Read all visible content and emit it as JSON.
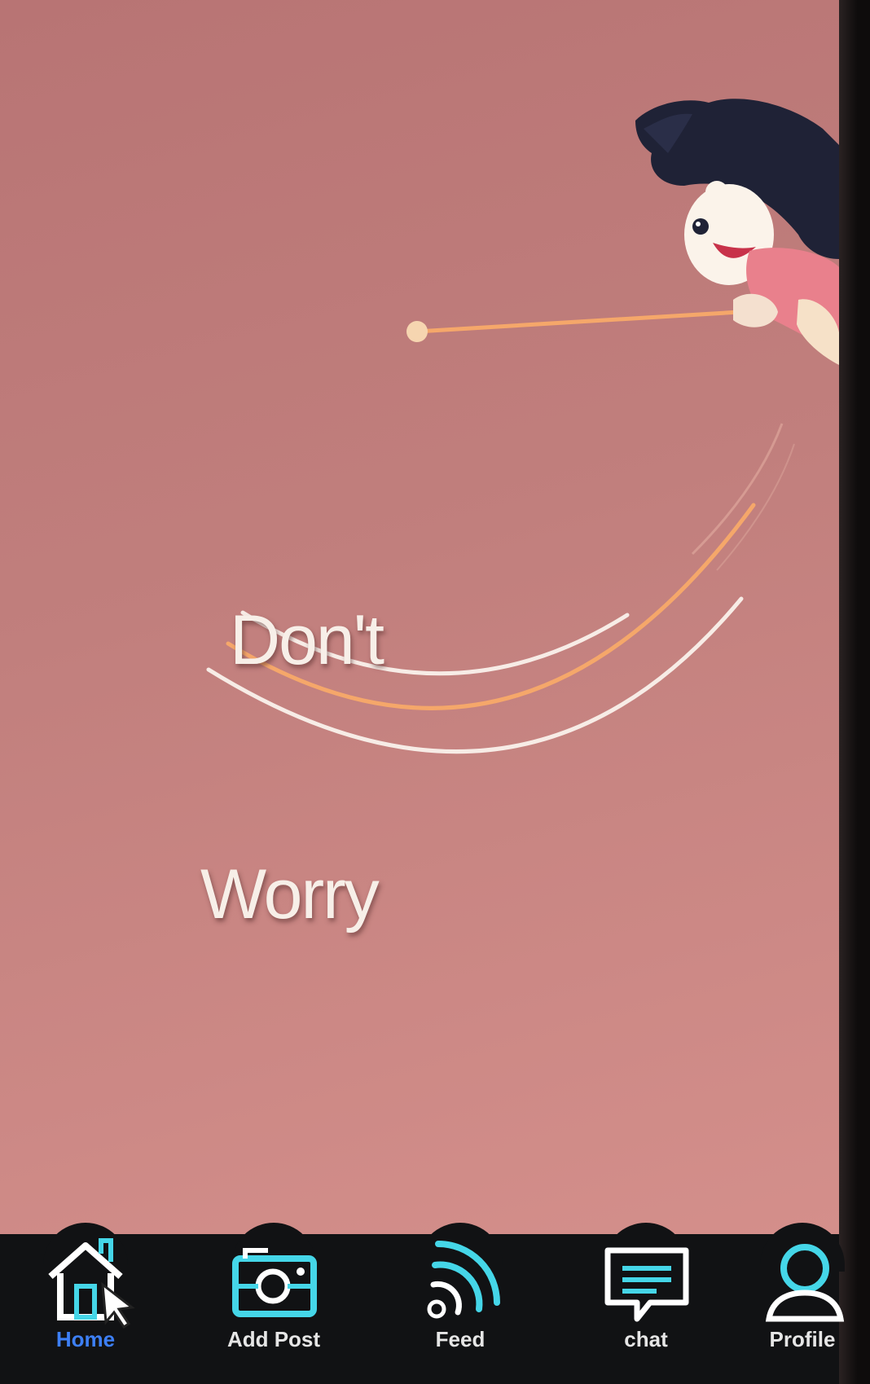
{
  "headline": {
    "line1": "Don't",
    "line2": "Worry"
  },
  "colors": {
    "background": "#c17f7d",
    "accent_orange": "#f5a76a",
    "text_light": "#f7efe8",
    "nav_background": "#111214",
    "nav_icon": "#45d6e8",
    "nav_active_label": "#3d7ff5"
  },
  "nav": {
    "items": [
      {
        "label": "Home",
        "icon": "home-icon",
        "active": true
      },
      {
        "label": "Add Post",
        "icon": "camera-icon",
        "active": false
      },
      {
        "label": "Feed",
        "icon": "rss-feed-icon",
        "active": false
      },
      {
        "label": "chat",
        "icon": "chat-bubble-icon",
        "active": false
      },
      {
        "label": "Profile",
        "icon": "profile-icon",
        "active": false
      }
    ]
  }
}
